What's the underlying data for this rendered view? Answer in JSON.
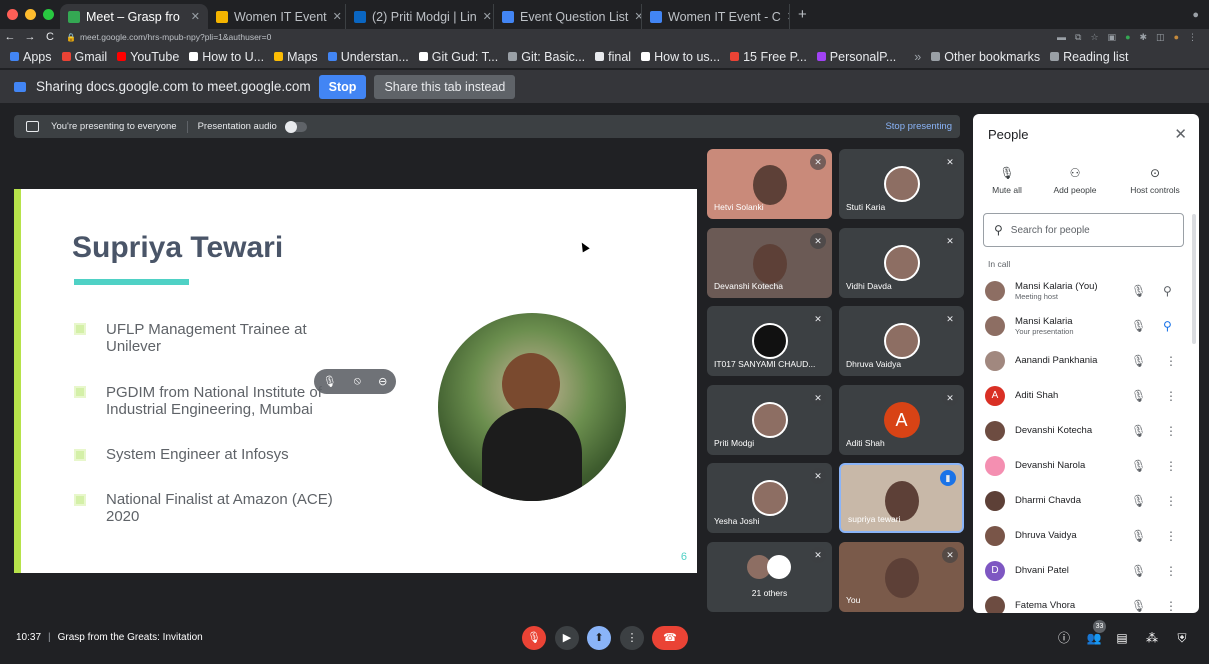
{
  "browser": {
    "tabs": [
      {
        "title": "Meet – Grasp fro",
        "active": true,
        "color": "#34a853"
      },
      {
        "title": "Women IT Event",
        "active": false,
        "color": "#f4b400"
      },
      {
        "title": "(2) Priti Modgi | Lin",
        "active": false,
        "color": "#0a66c2"
      },
      {
        "title": "Event Question List",
        "active": false,
        "color": "#4285f4"
      },
      {
        "title": "Women IT Event - C",
        "active": false,
        "color": "#4285f4"
      }
    ],
    "url": "meet.google.com/hrs-mpub-npy?pli=1&authuser=0",
    "bookmarks": [
      "Apps",
      "Gmail",
      "YouTube",
      "How to U...",
      "Maps",
      "Understan...",
      "Git Gud: T...",
      "Git: Basic...",
      "final",
      "How to us...",
      "15 Free P...",
      "PersonalP..."
    ],
    "bookmark_colors": [
      "#4285f4",
      "#ea4335",
      "#ff0000",
      "#fff",
      "#fbbc04",
      "#4285f4",
      "#fff",
      "#9aa0a6",
      "#e8eaed",
      "#fff",
      "#ea4335",
      "#a142f4"
    ],
    "other_bookmarks": "Other bookmarks",
    "reading_list": "Reading list"
  },
  "share": {
    "text": "Sharing docs.google.com to meet.google.com",
    "stop": "Stop",
    "share_tab": "Share this tab instead"
  },
  "presenting": {
    "text": "You're presenting to everyone",
    "audio": "Presentation audio",
    "stop": "Stop presenting"
  },
  "slide": {
    "name": "Supriya Tewari",
    "bullets": [
      "UFLP Management Trainee at Unilever",
      "PGDIM from National Institute of Industrial Engineering, Mumbai",
      "System Engineer at Infosys",
      "National Finalist at Amazon (ACE) 2020"
    ],
    "page": "6"
  },
  "tiles": [
    {
      "name": "Hetvi Solanki"
    },
    {
      "name": "Stuti Karia"
    },
    {
      "name": "Devanshi Kotecha"
    },
    {
      "name": "Vidhi Davda"
    },
    {
      "name": "IT017 SANYAMI CHAUD..."
    },
    {
      "name": "Dhruva Vaidya"
    },
    {
      "name": "Priti Modgi"
    },
    {
      "name": "Aditi Shah",
      "initial": "A"
    },
    {
      "name": "Yesha Joshi"
    },
    {
      "name": "supriya tewari"
    },
    {
      "name": "21 others"
    },
    {
      "name": "You"
    }
  ],
  "people": {
    "title": "People",
    "mute_all": "Mute all",
    "add_people": "Add people",
    "host_controls": "Host controls",
    "search_placeholder": "Search for people",
    "in_call": "In call",
    "list": [
      {
        "name": "Mansi Kalaria (You)",
        "sub": "Meeting host",
        "color": "#8d6e63"
      },
      {
        "name": "Mansi Kalaria",
        "sub": "Your presentation",
        "color": "#8d6e63"
      },
      {
        "name": "Aanandi Pankhania",
        "sub": "",
        "color": "#a1887f"
      },
      {
        "name": "Aditi Shah",
        "sub": "",
        "color": "#d93025",
        "initial": "A"
      },
      {
        "name": "Devanshi Kotecha",
        "sub": "",
        "color": "#6d4c41"
      },
      {
        "name": "Devanshi Narola",
        "sub": "",
        "color": "#f48fb1"
      },
      {
        "name": "Dharmi Chavda",
        "sub": "",
        "color": "#5d4037"
      },
      {
        "name": "Dhruva Vaidya",
        "sub": "",
        "color": "#795548"
      },
      {
        "name": "Dhvani Patel",
        "sub": "",
        "color": "#7e57c2",
        "initial": "D"
      },
      {
        "name": "Fatema Vhora",
        "sub": "",
        "color": "#6d4c41"
      }
    ]
  },
  "bottom": {
    "time": "10:37",
    "meeting": "Grasp from the Greats: Invitation",
    "people_count": "33"
  }
}
